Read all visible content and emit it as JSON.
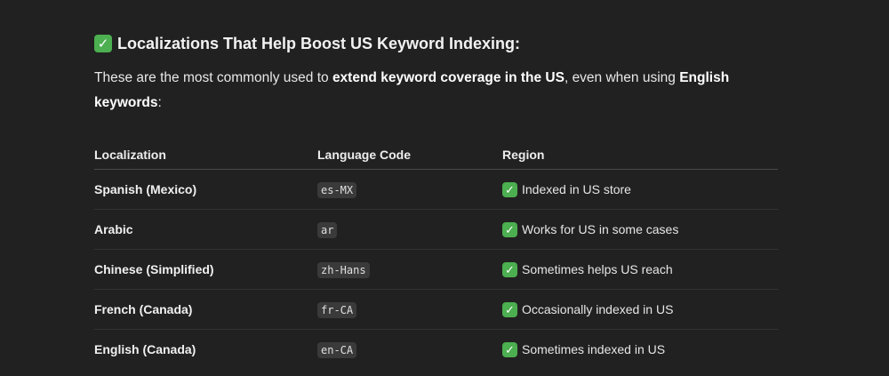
{
  "heading": {
    "icon": "check-mark-button-icon",
    "text": "Localizations That Help Boost US Keyword Indexing:"
  },
  "intro": {
    "part1": "These are the most commonly used to ",
    "bold1": "extend keyword coverage in the US",
    "part2": ", even when using ",
    "bold2": "English keywords",
    "part3": ":"
  },
  "table": {
    "headers": [
      "Localization",
      "Language Code",
      "Region"
    ],
    "rows": [
      {
        "localization": "Spanish (Mexico)",
        "code": "es-MX",
        "region": "Indexed in US store"
      },
      {
        "localization": "Arabic",
        "code": "ar",
        "region": "Works for US in some cases"
      },
      {
        "localization": "Chinese (Simplified)",
        "code": "zh-Hans",
        "region": "Sometimes helps US reach"
      },
      {
        "localization": "French (Canada)",
        "code": "fr-CA",
        "region": "Occasionally indexed in US"
      },
      {
        "localization": "English (Canada)",
        "code": "en-CA",
        "region": "Sometimes indexed in US"
      }
    ]
  },
  "colors": {
    "background": "#212121",
    "check_green": "#4caf50",
    "code_bg": "#3a3a3a"
  }
}
